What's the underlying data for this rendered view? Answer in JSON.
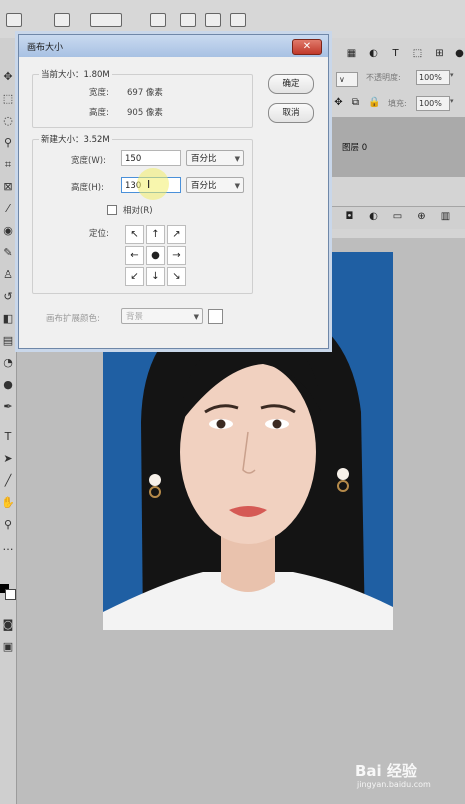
{
  "dialog": {
    "title": "画布大小",
    "current_size": {
      "legend": "当前大小：1.80M",
      "width_label": "宽度:",
      "width_value": "697 像素",
      "height_label": "高度:",
      "height_value": "905 像素"
    },
    "new_size": {
      "legend": "新建大小：3.52M",
      "width_label": "宽度(W):",
      "width_value": "150",
      "width_unit": "百分比",
      "height_label": "高度(H):",
      "height_value": "130",
      "height_unit": "百分比",
      "relative_label": "相对(R)",
      "anchor_label": "定位:"
    },
    "extension_color_label": "画布扩展颜色:",
    "extension_color_value": "背景",
    "ok_label": "确定",
    "cancel_label": "取消"
  },
  "panels": {
    "opacity_label": "不透明度:",
    "opacity_value": "100%",
    "fill_label": "填充:",
    "fill_value": "100%",
    "layer_name": "图层 0"
  },
  "watermark": {
    "brand": "Bai 经验",
    "url": "jingyan.baidu.com"
  },
  "colors": {
    "photo_background": "#1f5fa3",
    "dialog_titlebar": "#b3c9e8",
    "close_button": "#c94a3a",
    "highlight": "#f3ef6a"
  }
}
